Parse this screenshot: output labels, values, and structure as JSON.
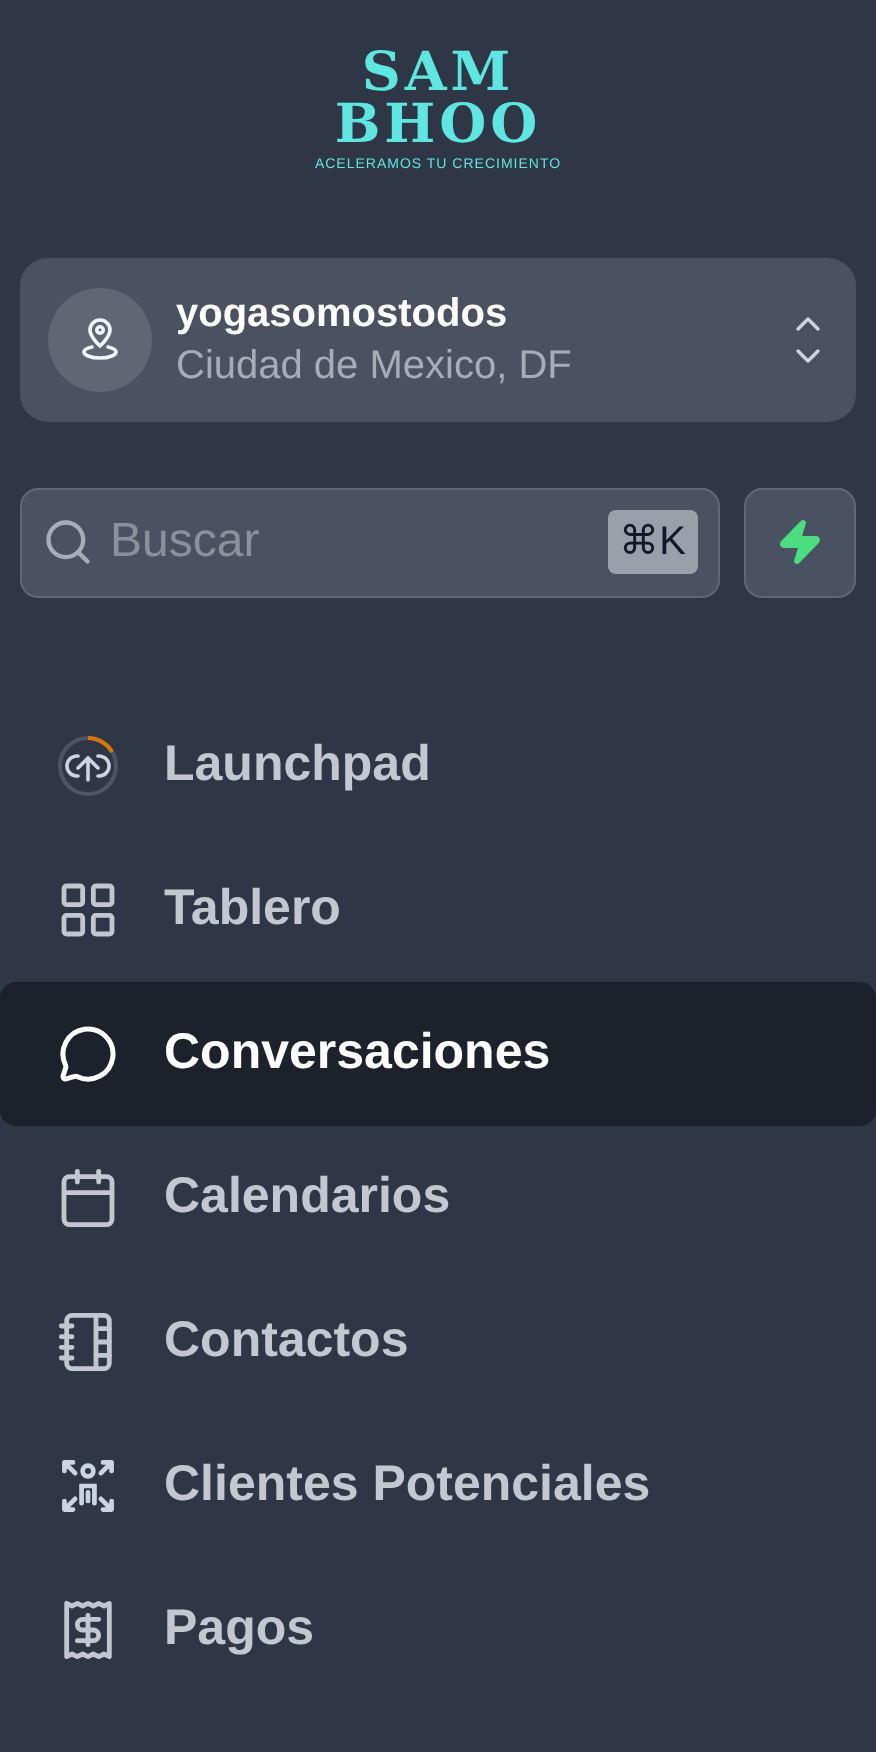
{
  "logo": {
    "line_1": "SAM",
    "line_2": "BHOO",
    "tagline": "ACELERAMOS TU CRECIMIENTO"
  },
  "account": {
    "name": "yogasomostodos",
    "location": "Ciudad de Mexico, DF"
  },
  "search": {
    "placeholder": "Buscar",
    "shortcut": "⌘K"
  },
  "nav": [
    {
      "label": "Launchpad",
      "selected": false
    },
    {
      "label": "Tablero",
      "selected": false
    },
    {
      "label": "Conversaciones",
      "selected": true
    },
    {
      "label": "Calendarios",
      "selected": false
    },
    {
      "label": "Contactos",
      "selected": false
    },
    {
      "label": "Clientes Potenciales",
      "selected": false
    },
    {
      "label": "Pagos",
      "selected": false
    }
  ]
}
